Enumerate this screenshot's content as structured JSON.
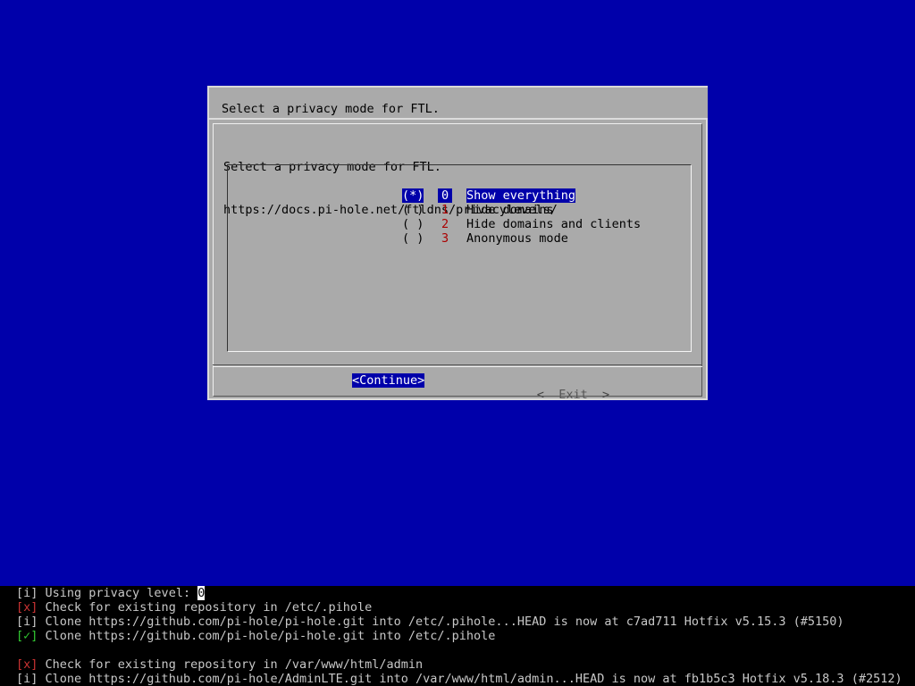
{
  "ghost_dialog": {
    "text": "Select a privacy mode for FTL."
  },
  "dialog": {
    "prompt_line1": "Select a privacy mode for FTL.",
    "prompt_line2": "https://docs.pi-hole.net/ftldns/privacylevels/",
    "options": [
      {
        "radio": "(*)",
        "tag": "0",
        "label": "Show everything",
        "selected": true
      },
      {
        "radio": "( )",
        "tag": "1",
        "label": "Hide domains",
        "selected": false
      },
      {
        "radio": "( )",
        "tag": "2",
        "label": "Hide domains and clients",
        "selected": false
      },
      {
        "radio": "( )",
        "tag": "3",
        "label": "Anonymous mode",
        "selected": false
      }
    ],
    "continue_label": "<Continue>",
    "exit_label": "Exit",
    "exit_left_chevron": "<",
    "exit_right_chevron": ">"
  },
  "terminal": {
    "lines": [
      {
        "badge": "[i]",
        "text": " Using privacy level: ",
        "value": "0"
      },
      {
        "badge": "[x]",
        "text": " Check for existing repository in /etc/.pihole"
      },
      {
        "badge": "[i]",
        "text": " Clone https://github.com/pi-hole/pi-hole.git into /etc/.pihole...HEAD is now at c7ad711 Hotfix v5.15.3 (#5150)"
      },
      {
        "badge": "[✓]",
        "text": " Clone https://github.com/pi-hole/pi-hole.git into /etc/.pihole"
      },
      {
        "badge": "",
        "text": ""
      },
      {
        "badge": "[x]",
        "text": " Check for existing repository in /var/www/html/admin"
      },
      {
        "badge": "[i]",
        "text": " Clone https://github.com/pi-hole/AdminLTE.git into /var/www/html/admin...HEAD is now at fb1b5c3 Hotfix v5.18.3 (#2512)"
      }
    ]
  },
  "colors": {
    "background": "#0000aa",
    "dialog": "#aaaaaa",
    "highlight": "#0000aa",
    "tag": "#aa0000",
    "terminal_bg": "#000000",
    "terminal_fg": "#c8c8c8"
  }
}
